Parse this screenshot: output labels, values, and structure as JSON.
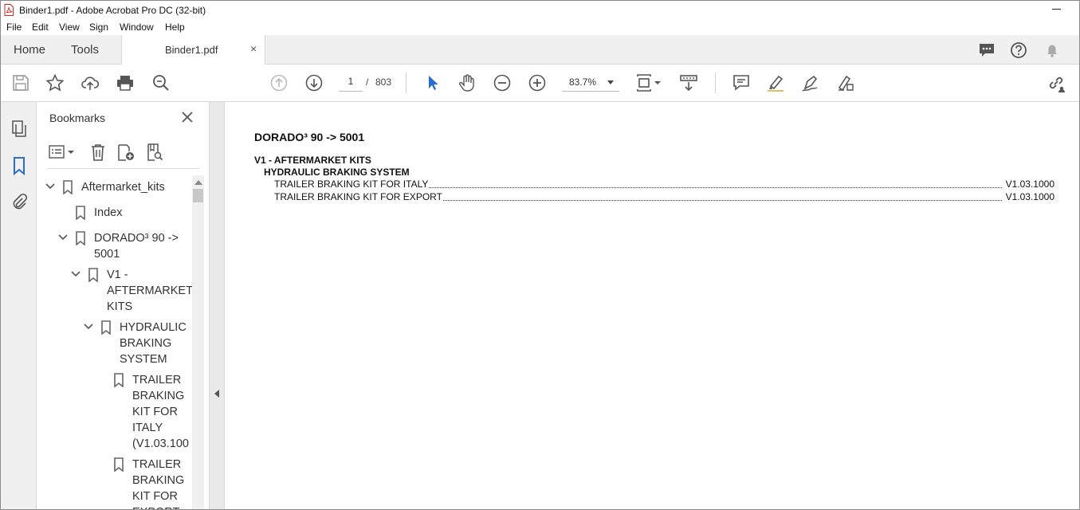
{
  "window": {
    "title": "Binder1.pdf - Adobe Acrobat Pro DC (32-bit)"
  },
  "menu": {
    "items": [
      "File",
      "Edit",
      "View",
      "Sign",
      "Window",
      "Help"
    ]
  },
  "tabs": {
    "home": "Home",
    "tools": "Tools",
    "document": "Binder1.pdf",
    "close": "×"
  },
  "toolbar": {
    "page_current": "1",
    "page_separator": "/",
    "page_total": "803",
    "zoom": "83.7%"
  },
  "bookmarks": {
    "title": "Bookmarks",
    "items": [
      {
        "label": "Aftermarket_kits",
        "expanded": true
      },
      {
        "label": "Index"
      },
      {
        "label": "DORADO³ 90 ->\n5001",
        "expanded": true
      },
      {
        "label": "V1 -\nAFTERMARKET\nKITS",
        "expanded": true
      },
      {
        "label": "HYDRAULIC\nBRAKING\nSYSTEM",
        "expanded": true
      },
      {
        "label": "TRAILER\nBRAKING\nKIT FOR\nITALY\n(V1.03.100"
      },
      {
        "label": "TRAILER\nBRAKING\nKIT FOR\nEXPORT"
      }
    ]
  },
  "document": {
    "heading": "DORADO³ 90 -> 5001",
    "section": "V1 - AFTERMARKET KITS",
    "subsection": "HYDRAULIC BRAKING SYSTEM",
    "entries": [
      {
        "title": "TRAILER BRAKING KIT FOR ITALY",
        "ref": "V1.03.1000"
      },
      {
        "title": "TRAILER BRAKING KIT FOR EXPORT",
        "ref": "V1.03.1000"
      }
    ]
  },
  "colors": {
    "accent_blue": "#2b6ccd",
    "pdf_red": "#d9231d"
  }
}
